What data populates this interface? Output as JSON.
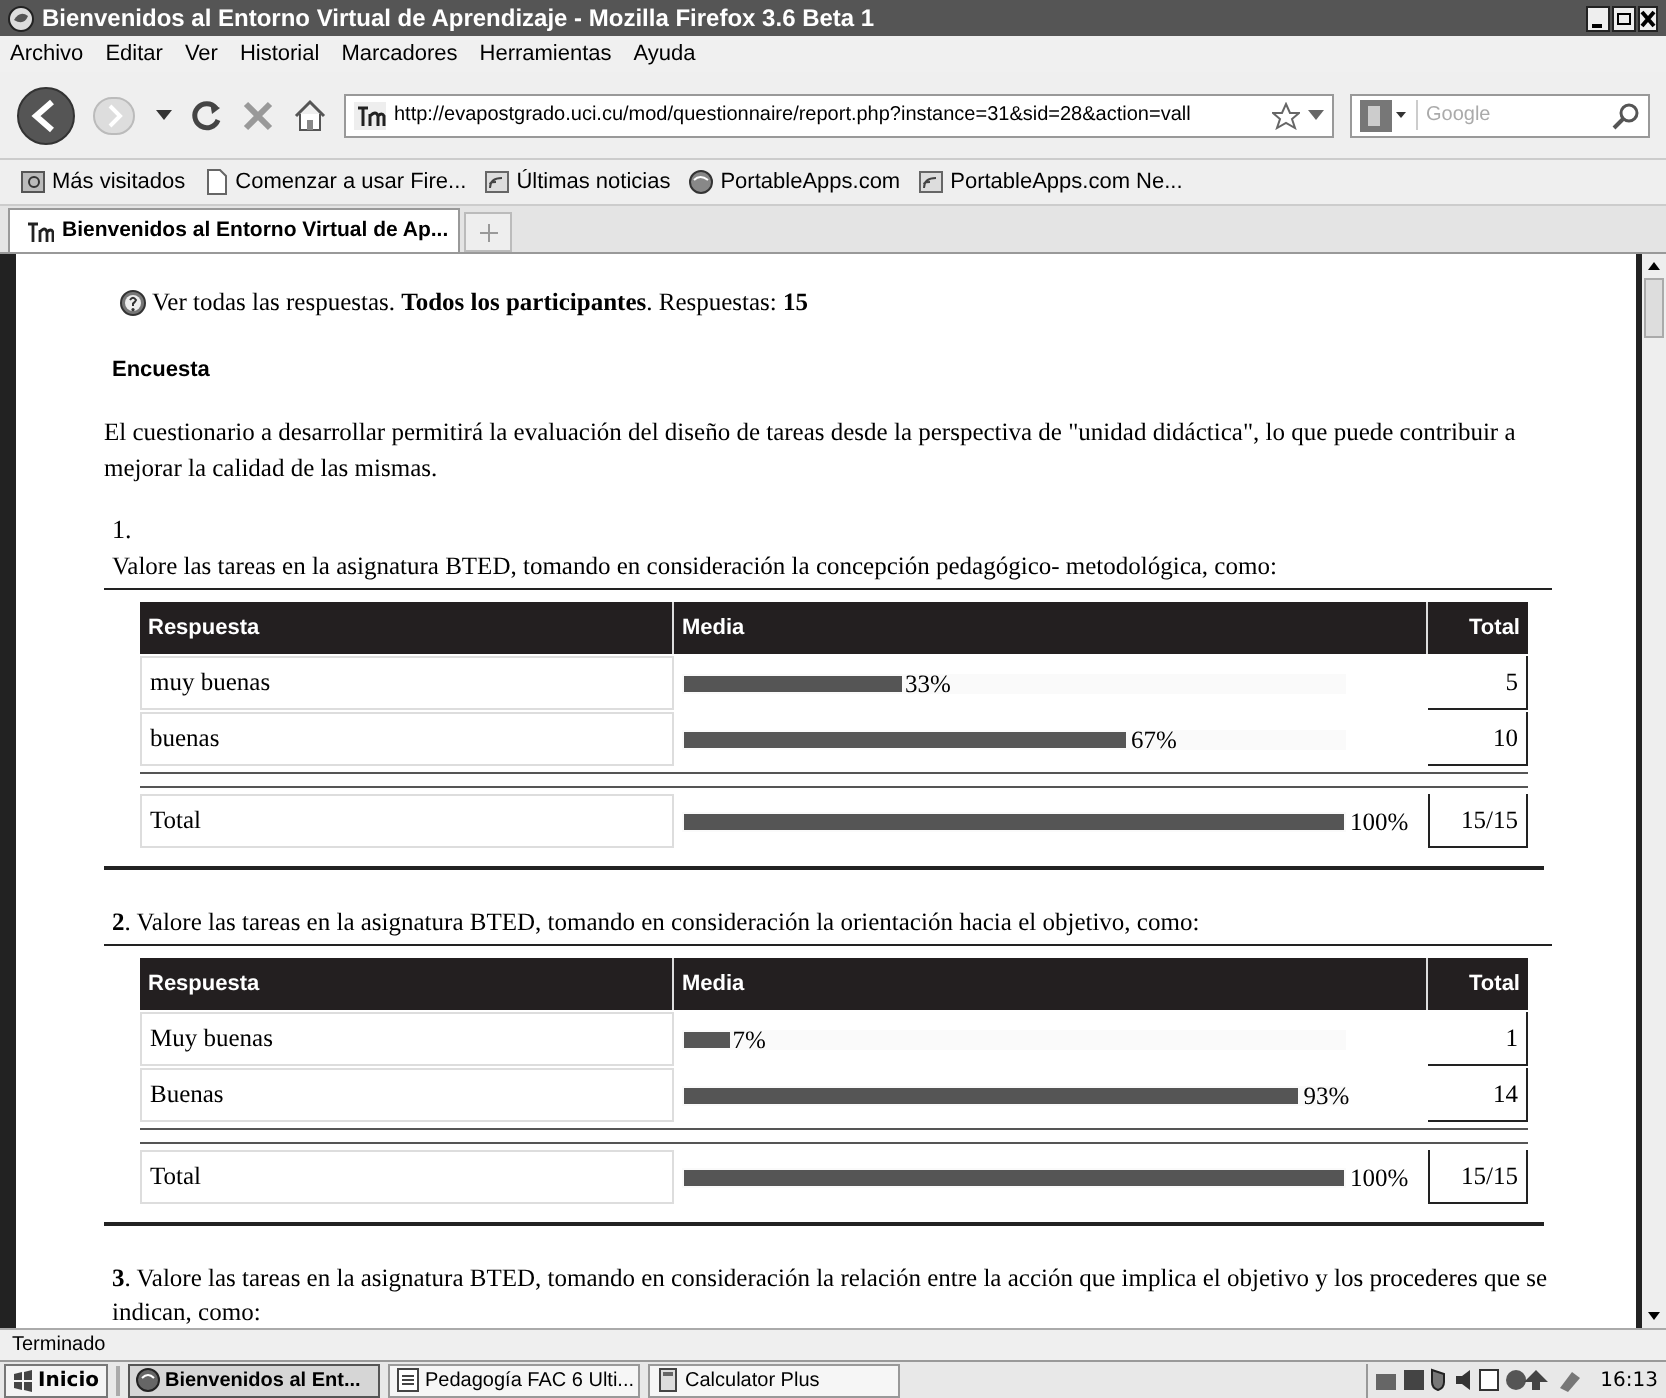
{
  "window": {
    "title": "Bienvenidos al Entorno Virtual de Aprendizaje - Mozilla Firefox 3.6 Beta 1"
  },
  "menu": [
    "Archivo",
    "Editar",
    "Ver",
    "Historial",
    "Marcadores",
    "Herramientas",
    "Ayuda"
  ],
  "toolbar": {
    "url": "http://evapostgrado.uci.cu/mod/questionnaire/report.php?instance=31&sid=28&action=vall",
    "search_placeholder": "Google"
  },
  "bookmarks": [
    {
      "label": "Más visitados",
      "kind": "folder"
    },
    {
      "label": "Comenzar a usar Fire...",
      "kind": "page"
    },
    {
      "label": "Últimas noticias",
      "kind": "feed"
    },
    {
      "label": "PortableApps.com",
      "kind": "globe"
    },
    {
      "label": "PortableApps.com Ne...",
      "kind": "feed"
    }
  ],
  "tabs": [
    {
      "label": "Bienvenidos al Entorno Virtual de Ap...",
      "selected": true
    }
  ],
  "content": {
    "summary": "Ver todas las respuestas. **Todos los participantes**. Respuestas: **15**",
    "heading": "Encuesta",
    "intro": "El cuestionario a desarrollar permitirá la evaluación del diseño de tareas desde la perspectiva de \"unidad didáctica\", lo que puede contribuir a mejorar la calidad de las mismas.",
    "questions": [
      {
        "number": "1.",
        "text": "Valore las tareas en la asignatura BTED, tomando en consideración la concepción pedagógico- metodológica, como:",
        "columns": [
          "Respuesta",
          "Media",
          "Total"
        ],
        "rows": [
          {
            "answer": "muy buenas",
            "level": 0.33,
            "percent": "33%",
            "total": "5"
          },
          {
            "answer": "buenas",
            "level": 0.67,
            "percent": "67%",
            "total": "10"
          }
        ],
        "total_row": {
          "label": "Total",
          "level": 1,
          "percent": "100%",
          "total": "15/15"
        }
      },
      {
        "text": "**2**. Valore las tareas en la asignatura BTED, tomando en consideración la orientación hacia el objetivo, como:",
        "columns": [
          "Respuesta",
          "Media",
          "Total"
        ],
        "rows": [
          {
            "answer": "Muy buenas",
            "level": 0.07,
            "percent": "7%",
            "total": "1"
          },
          {
            "answer": "Buenas",
            "level": 0.93,
            "percent": "93%",
            "total": "14"
          }
        ],
        "total_row": {
          "label": "Total",
          "level": 1,
          "percent": "100%",
          "total": "15/15"
        }
      },
      {
        "text": "**3**. Valore las tareas en la asignatura BTED, tomando en consideración la relación entre la acción que implica el objetivo y los procederes que se indican, como:"
      }
    ]
  },
  "status_bar": "Terminado",
  "taskbar": {
    "start": "Inicio",
    "tasks": [
      {
        "label": "Bienvenidos al Ent...",
        "selected": true,
        "kind": "browser"
      },
      {
        "label": "Pedagogía FAC 6 Ulti...",
        "selected": false,
        "kind": "document"
      },
      {
        "label": "Calculator Plus",
        "selected": false,
        "kind": "calculator"
      }
    ],
    "clock": "16:13"
  }
}
